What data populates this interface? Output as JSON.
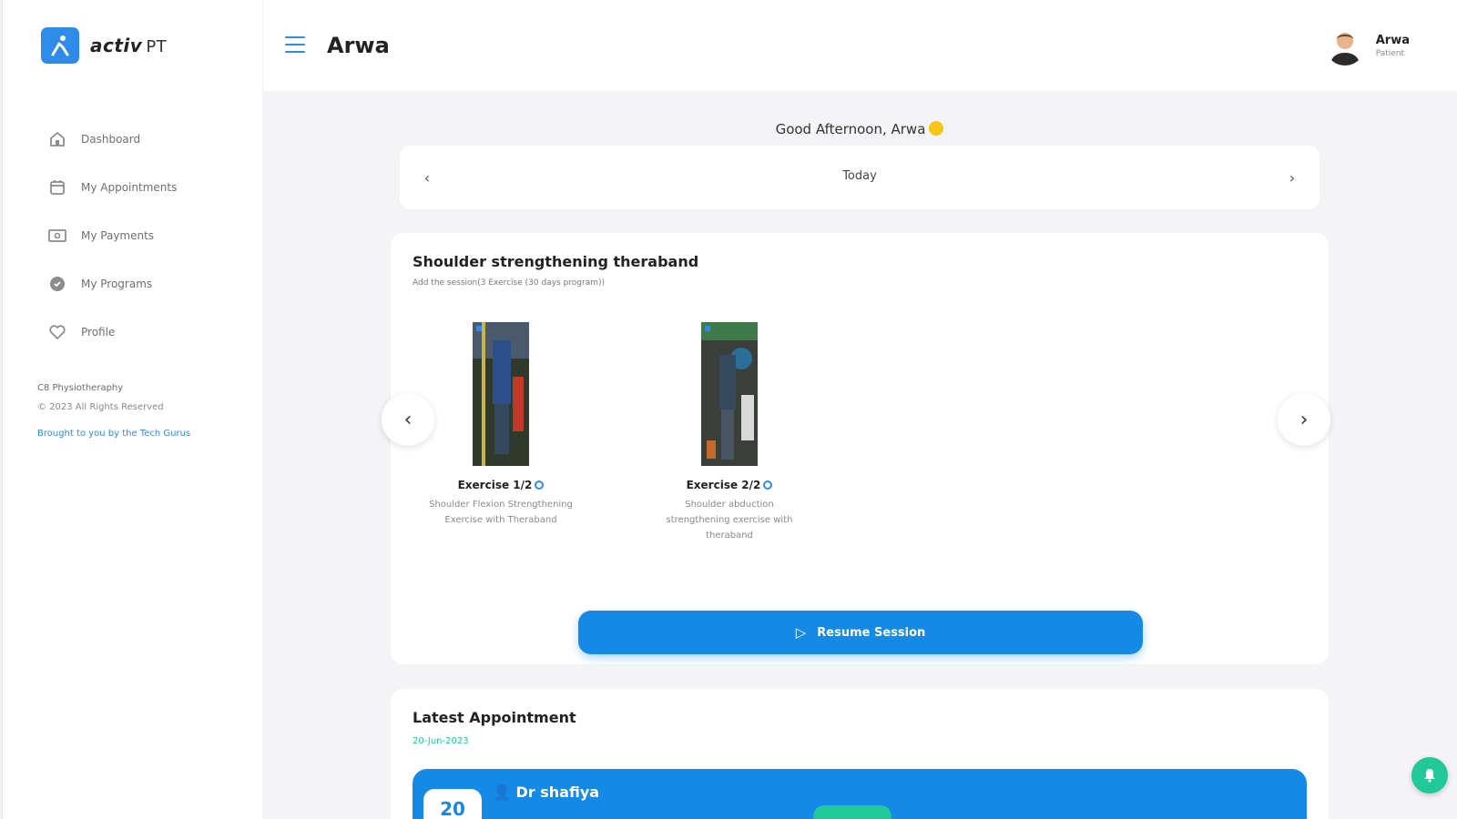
{
  "brand": {
    "logo_text": "activ",
    "logo_suffix": "PT",
    "color": "#2e8be8"
  },
  "sidebar": {
    "items": [
      {
        "label": "Dashboard",
        "icon": "home-icon"
      },
      {
        "label": "My Appointments",
        "icon": "calendar-icon"
      },
      {
        "label": "My Payments",
        "icon": "payment-icon"
      },
      {
        "label": "My Programs",
        "icon": "programs-icon"
      },
      {
        "label": "Profile",
        "icon": "heart-icon"
      }
    ],
    "footer": {
      "company": "C8 Physiotheraphy",
      "copyright": "© 2023 All Rights Reserved",
      "credit": "Brought to you by the Tech Gurus"
    }
  },
  "header": {
    "title": "Arwa",
    "user": {
      "name": "Arwa",
      "role": "Patient"
    }
  },
  "greeting": "Good Afternoon, Arwa",
  "date_nav": {
    "label": "Today"
  },
  "program": {
    "title": "Shoulder strengthening theraband",
    "subtitle": "Add the session(3 Exercise (30 days program))",
    "exercises": [
      {
        "title": "Exercise 1/2",
        "desc": "Shoulder Flexion Strengthening Exercise with Theraband"
      },
      {
        "title": "Exercise 2/2",
        "desc": "Shoulder abduction strengthening exercise with theraband"
      }
    ],
    "resume_label": "Resume Session"
  },
  "appointment": {
    "title": "Latest Appointment",
    "date": "20-Jun-2023",
    "day": "20",
    "doctor": "Dr shafiya",
    "time": "",
    "colors": {
      "primary": "#1589e6",
      "status": "#20c997"
    }
  }
}
